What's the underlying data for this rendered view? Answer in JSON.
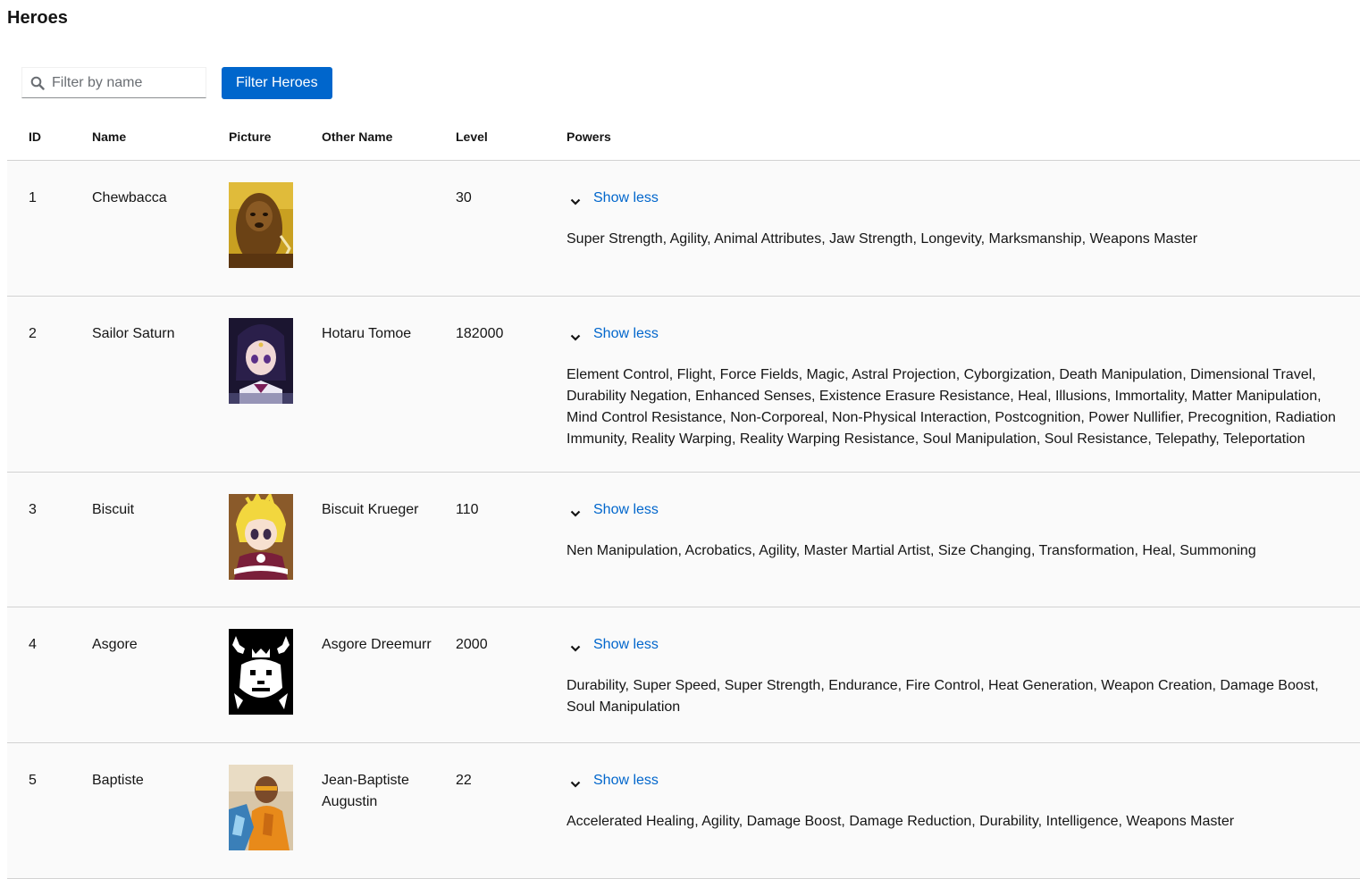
{
  "page": {
    "title": "Heroes"
  },
  "toolbar": {
    "search_placeholder": "Filter by name",
    "search_value": "",
    "filter_button_label": "Filter Heroes",
    "search_icon": "search-icon"
  },
  "table": {
    "columns": {
      "id": "ID",
      "name": "Name",
      "picture": "Picture",
      "other_name": "Other Name",
      "level": "Level",
      "powers": "Powers"
    },
    "rows": [
      {
        "id": "1",
        "name": "Chewbacca",
        "other_name": "",
        "level": "30",
        "toggle_label": "Show less",
        "powers": "Super Strength, Agility, Animal Attributes, Jaw Strength, Longevity, Marksmanship, Weapons Master"
      },
      {
        "id": "2",
        "name": "Sailor Saturn",
        "other_name": "Hotaru Tomoe",
        "level": "182000",
        "toggle_label": "Show less",
        "powers": "Element Control, Flight, Force Fields, Magic, Astral Projection, Cyborgization, Death Manipulation, Dimensional Travel, Durability Negation, Enhanced Senses, Existence Erasure Resistance, Heal, Illusions, Immortality, Matter Manipulation, Mind Control Resistance, Non-Corporeal, Non-Physical Interaction, Postcognition, Power Nullifier, Precognition, Radiation Immunity, Reality Warping, Reality Warping Resistance, Soul Manipulation, Soul Resistance, Telepathy, Teleportation"
      },
      {
        "id": "3",
        "name": "Biscuit",
        "other_name": "Biscuit Krueger",
        "level": "110",
        "toggle_label": "Show less",
        "powers": "Nen Manipulation, Acrobatics, Agility, Master Martial Artist, Size Changing, Transformation, Heal, Summoning"
      },
      {
        "id": "4",
        "name": "Asgore",
        "other_name": "Asgore Dreemurr",
        "level": "2000",
        "toggle_label": "Show less",
        "powers": "Durability, Super Speed, Super Strength, Endurance, Fire Control, Heat Generation, Weapon Creation, Damage Boost, Soul Manipulation"
      },
      {
        "id": "5",
        "name": "Baptiste",
        "other_name": "Jean-Baptiste Augustin",
        "level": "22",
        "toggle_label": "Show less",
        "powers": "Accelerated Healing, Agility, Damage Boost, Damage Reduction, Durability, Intelligence, Weapons Master"
      }
    ]
  },
  "colors": {
    "primary": "#0066cc",
    "row_background": "#fafafa",
    "border": "#d2d2d2",
    "text": "#151515"
  }
}
